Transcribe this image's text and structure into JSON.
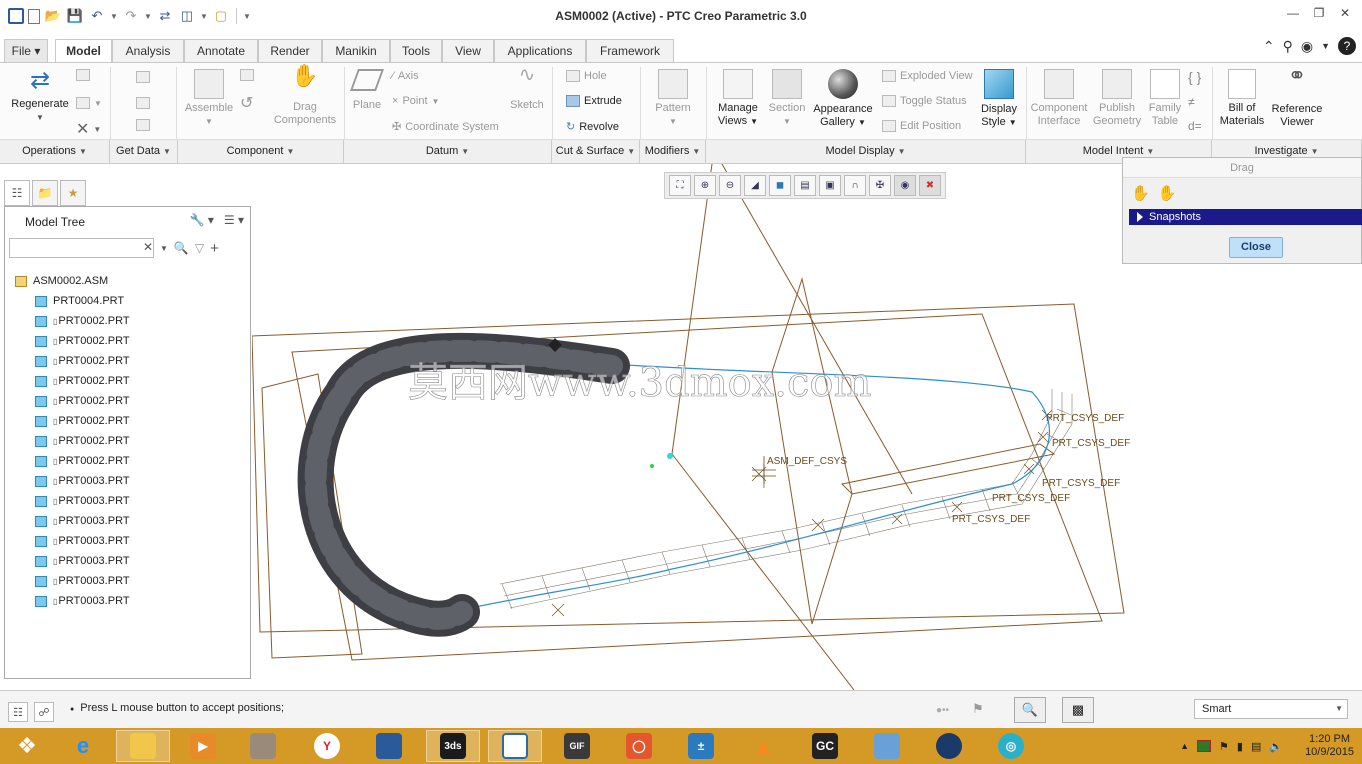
{
  "titlebar": {
    "title": "ASM0002 (Active) - PTC Creo Parametric 3.0",
    "qat_icons": [
      "app-icon",
      "new-icon",
      "open-icon",
      "save-icon",
      "undo-icon",
      "redo-icon",
      "regenerate-icon",
      "windows-icon",
      "close-window-icon",
      "customize-icon"
    ],
    "window_controls": [
      "minimize-icon",
      "restore-icon",
      "close-icon"
    ]
  },
  "tabs": [
    "File",
    "Model",
    "Analysis",
    "Annotate",
    "Render",
    "Manikin",
    "Tools",
    "View",
    "Applications",
    "Framework"
  ],
  "active_tab": "Model",
  "ribbon": {
    "regenerate": "Regenerate",
    "assemble": "Assemble",
    "drag_components": [
      "Drag",
      "Components"
    ],
    "plane": "Plane",
    "axis": "Axis",
    "point": "Point",
    "coordinate_system": "Coordinate System",
    "sketch": "Sketch",
    "hole": "Hole",
    "extrude": "Extrude",
    "revolve": "Revolve",
    "pattern": "Pattern",
    "manage_views": [
      "Manage",
      "Views"
    ],
    "section": "Section",
    "appearance_gallery": [
      "Appearance",
      "Gallery"
    ],
    "exploded_view": "Exploded View",
    "toggle_status": "Toggle Status",
    "edit_position": "Edit Position",
    "display_style": [
      "Display",
      "Style"
    ],
    "component_interface": [
      "Component",
      "Interface"
    ],
    "publish_geometry": [
      "Publish",
      "Geometry"
    ],
    "family_table": [
      "Family",
      "Table"
    ],
    "bill_of_materials": [
      "Bill of",
      "Materials"
    ],
    "reference_viewer": [
      "Reference",
      "Viewer"
    ]
  },
  "groups": [
    "Operations",
    "Get Data",
    "Component",
    "Datum",
    "Cut & Surface",
    "Modifiers",
    "Model Display",
    "Model Intent",
    "Investigate"
  ],
  "navigator": {
    "tabs": [
      "model-tree-tab-icon",
      "folder-browser-tab-icon",
      "favorites-tab-icon"
    ],
    "title": "Model Tree",
    "search_value": "",
    "root": "ASM0002.ASM",
    "items": [
      {
        "name": "PRT0004.PRT",
        "marker": false
      },
      {
        "name": "PRT0002.PRT",
        "marker": true
      },
      {
        "name": "PRT0002.PRT",
        "marker": true
      },
      {
        "name": "PRT0002.PRT",
        "marker": true
      },
      {
        "name": "PRT0002.PRT",
        "marker": true
      },
      {
        "name": "PRT0002.PRT",
        "marker": true
      },
      {
        "name": "PRT0002.PRT",
        "marker": true
      },
      {
        "name": "PRT0002.PRT",
        "marker": true
      },
      {
        "name": "PRT0002.PRT",
        "marker": true
      },
      {
        "name": "PRT0003.PRT",
        "marker": true
      },
      {
        "name": "PRT0003.PRT",
        "marker": true
      },
      {
        "name": "PRT0003.PRT",
        "marker": true
      },
      {
        "name": "PRT0003.PRT",
        "marker": true
      },
      {
        "name": "PRT0003.PRT",
        "marker": true
      },
      {
        "name": "PRT0003.PRT",
        "marker": true
      },
      {
        "name": "PRT0003.PRT",
        "marker": true
      }
    ]
  },
  "viewport": {
    "watermark": "莫西网www.3dmox.com",
    "labels": {
      "asm_csys": "ASM_DEF_CSYS",
      "prt_csys_1": "PRT_CSYS_DEF",
      "prt_csys_2": "PRT_CSYS_DEF",
      "prt_csys_3": "PRT_CSYS_DEF",
      "prt_csys_4": "PRT_CSYS_DEF",
      "prt_csys_5": "PRT_CSYS_DEF"
    },
    "colors": {
      "datum": "#8a5a2a",
      "chain": "#3d3f45",
      "path": "#2c8fd1",
      "label": "#6a4a1a"
    }
  },
  "drag_panel": {
    "title": "Drag",
    "snapshots": "Snapshots",
    "close": "Close"
  },
  "status": {
    "message": "Press L mouse button to accept positions;",
    "filter": "Smart"
  },
  "taskbar": {
    "apps": [
      "windows-start-icon",
      "ie-icon",
      "file-explorer-icon",
      "media-player-icon",
      "firewall-icon",
      "opera-icon",
      "explorer-icon",
      "3dsmax-icon",
      "creo-icon",
      "gif-icon",
      "office-icon",
      "calculator-icon",
      "vlc-icon",
      "gc-icon",
      "network-icon",
      "kerkythea-icon",
      "rainmeter-icon"
    ],
    "time": "1:20 PM",
    "date": "10/9/2015"
  }
}
